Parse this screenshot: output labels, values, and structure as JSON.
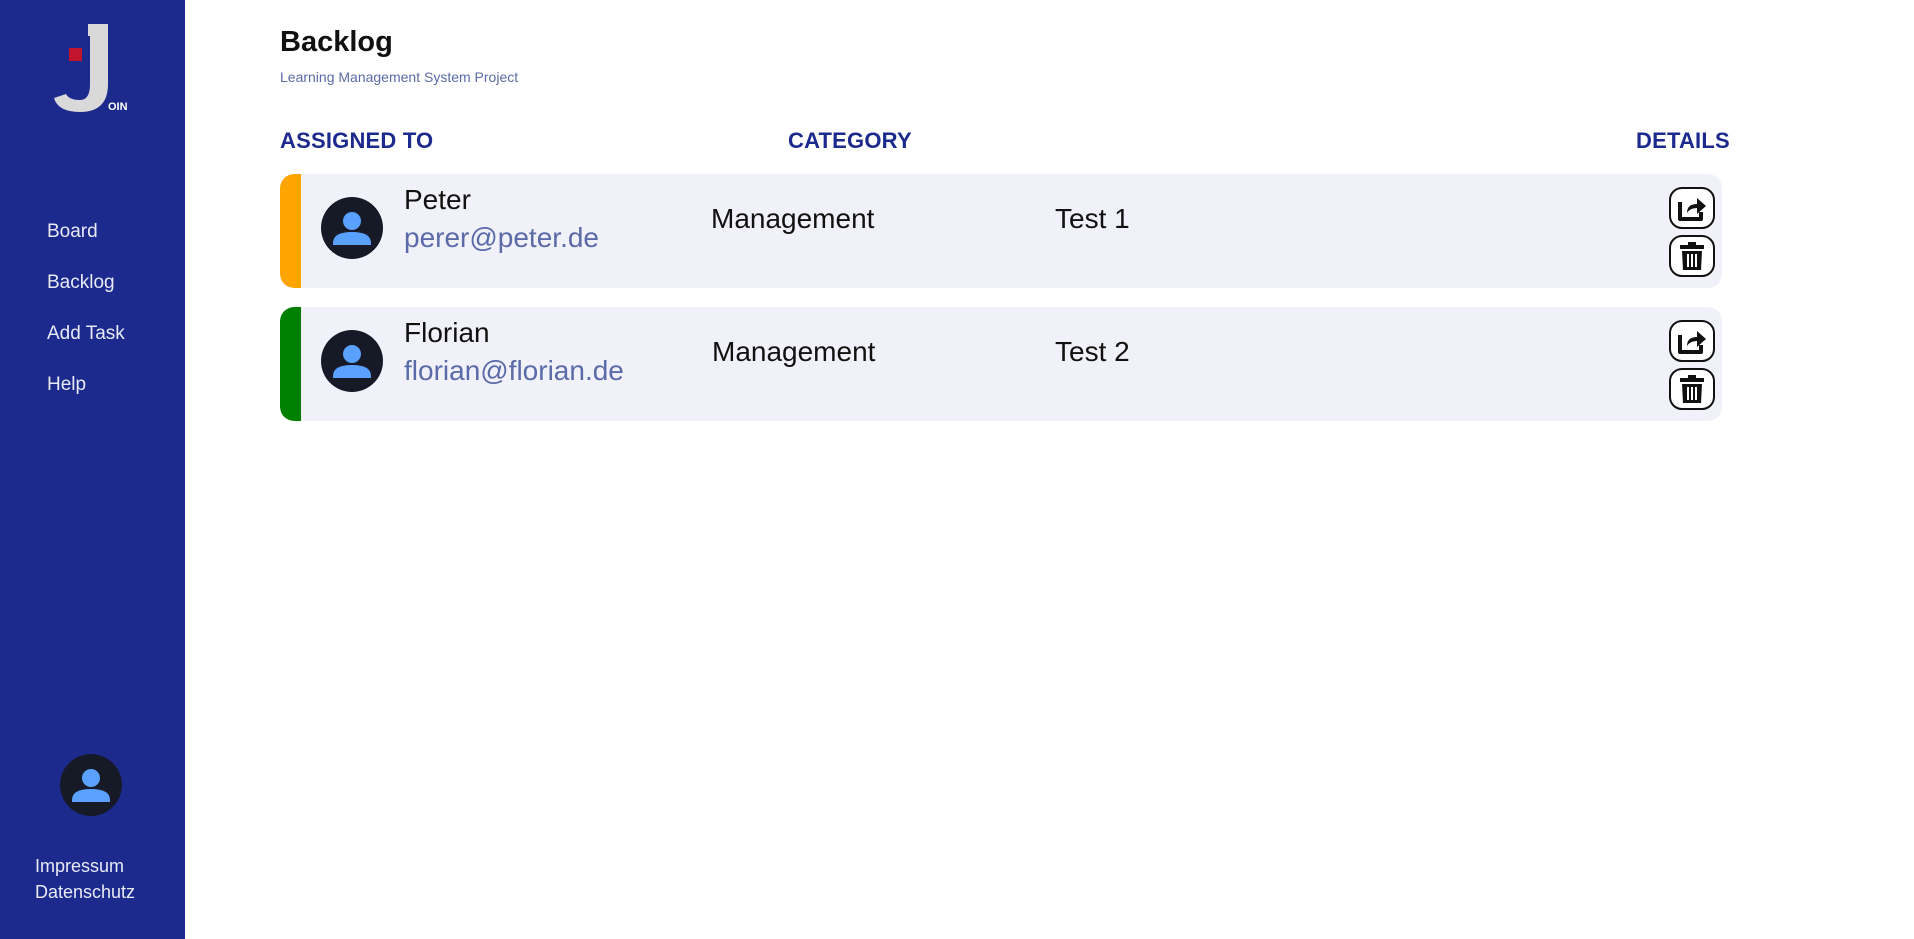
{
  "sidebar": {
    "logo_text": "OIN",
    "nav": [
      "Board",
      "Backlog",
      "Add Task",
      "Help"
    ],
    "legal": [
      "Impressum",
      "Datenschutz"
    ]
  },
  "header": {
    "title": "Backlog",
    "subtitle": "Learning Management System Project"
  },
  "columns": {
    "assigned": "ASSIGNED TO",
    "category": "CATEGORY",
    "details": "DETAILS"
  },
  "rows": [
    {
      "name": "Peter",
      "email": "perer@peter.de",
      "category": "Management",
      "title": "Test 1",
      "color": "#ffa500"
    },
    {
      "name": "Florian",
      "email": "florian@florian.de",
      "category": "Management",
      "title": "Test 2",
      "color": "#008000"
    }
  ],
  "icons": {
    "open": "share-icon",
    "delete": "trash-icon",
    "avatar": "user-avatar-icon"
  },
  "colors": {
    "sidebar": "#1c2a8e",
    "accent": "#1c2a8e",
    "logo_red": "#c0152c",
    "row_bg": "#f1f1f9",
    "email": "#5b6aa8"
  }
}
